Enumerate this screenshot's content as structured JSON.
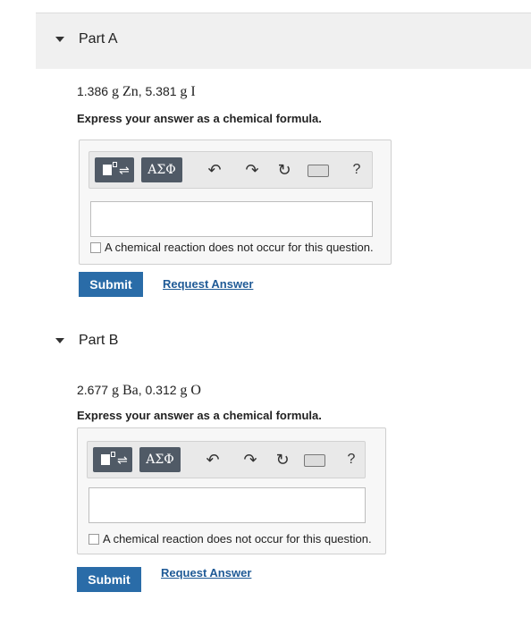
{
  "partA": {
    "title": "Part A",
    "problem_prefix": "1.386 ",
    "problem_unit1": "g Zn",
    "problem_mid": ", 5.381 ",
    "problem_unit2": "g I",
    "instruction": "Express your answer as a chemical formula.",
    "toolbar": {
      "greek": "ΑΣΦ",
      "help": "?"
    },
    "no_reaction_label": "A chemical reaction does not occur for this question.",
    "submit_label": "Submit",
    "request_label": "Request Answer"
  },
  "partB": {
    "title": "Part B",
    "problem_prefix": "2.677 ",
    "problem_unit1": "g Ba",
    "problem_mid": ", 0.312 ",
    "problem_unit2": "g O",
    "instruction": "Express your answer as a chemical formula.",
    "toolbar": {
      "greek": "ΑΣΦ",
      "help": "?"
    },
    "no_reaction_label": "A chemical reaction does not occur for this question.",
    "submit_label": "Submit",
    "request_label": "Request Answer"
  },
  "icons": {
    "undo": "↶",
    "redo": "↷",
    "reset": "↻",
    "templates": "templates-icon",
    "keyboard": "keyboard-icon"
  }
}
